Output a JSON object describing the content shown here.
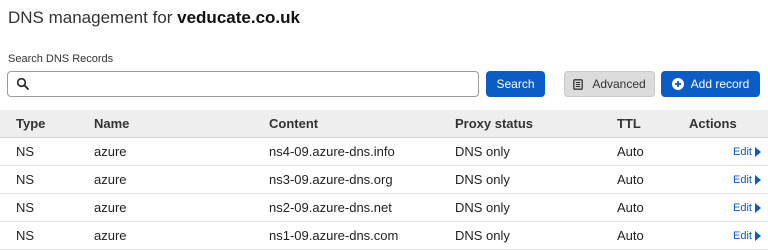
{
  "header": {
    "title_prefix": "DNS management for",
    "domain": "veducate.co.uk"
  },
  "search": {
    "label": "Search DNS Records",
    "value": "",
    "placeholder": "",
    "button_label": "Search"
  },
  "toolbar": {
    "advanced_label": "Advanced",
    "add_record_label": "Add record"
  },
  "table": {
    "columns": [
      "Type",
      "Name",
      "Content",
      "Proxy status",
      "TTL",
      "Actions"
    ],
    "rows": [
      {
        "type": "NS",
        "name": "azure",
        "content": "ns4-09.azure-dns.info",
        "proxy": "DNS only",
        "ttl": "Auto",
        "action": "Edit"
      },
      {
        "type": "NS",
        "name": "azure",
        "content": "ns3-09.azure-dns.org",
        "proxy": "DNS only",
        "ttl": "Auto",
        "action": "Edit"
      },
      {
        "type": "NS",
        "name": "azure",
        "content": "ns2-09.azure-dns.net",
        "proxy": "DNS only",
        "ttl": "Auto",
        "action": "Edit"
      },
      {
        "type": "NS",
        "name": "azure",
        "content": "ns1-09.azure-dns.com",
        "proxy": "DNS only",
        "ttl": "Auto",
        "action": "Edit"
      }
    ]
  },
  "colors": {
    "primary": "#0b5cc4",
    "header_bg": "#eeeeee",
    "secondary_button": "#dcdcdc"
  },
  "icons": {
    "search": "search-icon",
    "advanced": "document-icon",
    "add": "plus-circle-icon",
    "edit": "caret-right-icon"
  }
}
